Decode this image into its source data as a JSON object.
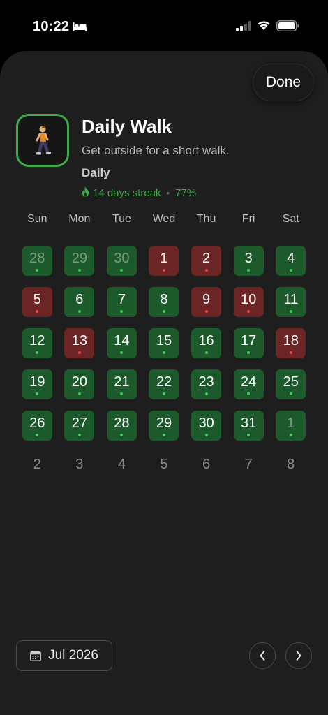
{
  "status_bar": {
    "time": "10:22",
    "icons": [
      "bed-icon",
      "cellular-signal-icon",
      "wifi-icon",
      "battery-icon"
    ]
  },
  "header": {
    "done_label": "Done"
  },
  "habit": {
    "icon": "person-walking-icon",
    "title": "Daily Walk",
    "description": "Get outside for a short walk.",
    "frequency": "Daily",
    "streak": "14 days streak",
    "separator": "•",
    "completion": "77%"
  },
  "calendar": {
    "weekdays": [
      "Sun",
      "Mon",
      "Tue",
      "Wed",
      "Thu",
      "Fri",
      "Sat"
    ],
    "days": [
      {
        "label": "28",
        "state": "done",
        "other_month": true
      },
      {
        "label": "29",
        "state": "done",
        "other_month": true
      },
      {
        "label": "30",
        "state": "done",
        "other_month": true
      },
      {
        "label": "1",
        "state": "missed",
        "other_month": false
      },
      {
        "label": "2",
        "state": "missed",
        "other_month": false
      },
      {
        "label": "3",
        "state": "done",
        "other_month": false
      },
      {
        "label": "4",
        "state": "done",
        "other_month": false
      },
      {
        "label": "5",
        "state": "missed",
        "other_month": false
      },
      {
        "label": "6",
        "state": "done",
        "other_month": false
      },
      {
        "label": "7",
        "state": "done",
        "other_month": false
      },
      {
        "label": "8",
        "state": "done",
        "other_month": false
      },
      {
        "label": "9",
        "state": "missed",
        "other_month": false
      },
      {
        "label": "10",
        "state": "missed",
        "other_month": false
      },
      {
        "label": "11",
        "state": "done",
        "other_month": false
      },
      {
        "label": "12",
        "state": "done",
        "other_month": false
      },
      {
        "label": "13",
        "state": "missed",
        "other_month": false
      },
      {
        "label": "14",
        "state": "done",
        "other_month": false
      },
      {
        "label": "15",
        "state": "done",
        "other_month": false
      },
      {
        "label": "16",
        "state": "done",
        "other_month": false
      },
      {
        "label": "17",
        "state": "done",
        "other_month": false
      },
      {
        "label": "18",
        "state": "missed",
        "other_month": false
      },
      {
        "label": "19",
        "state": "done",
        "other_month": false
      },
      {
        "label": "20",
        "state": "done",
        "other_month": false
      },
      {
        "label": "21",
        "state": "done",
        "other_month": false
      },
      {
        "label": "22",
        "state": "done",
        "other_month": false
      },
      {
        "label": "23",
        "state": "done",
        "other_month": false
      },
      {
        "label": "24",
        "state": "done",
        "other_month": false
      },
      {
        "label": "25",
        "state": "done",
        "other_month": false
      },
      {
        "label": "26",
        "state": "done",
        "other_month": false
      },
      {
        "label": "27",
        "state": "done",
        "other_month": false
      },
      {
        "label": "28",
        "state": "done",
        "other_month": false
      },
      {
        "label": "29",
        "state": "done",
        "other_month": false
      },
      {
        "label": "30",
        "state": "done",
        "other_month": false
      },
      {
        "label": "31",
        "state": "done",
        "other_month": false
      },
      {
        "label": "1",
        "state": "done",
        "other_month": true
      },
      {
        "label": "2",
        "state": "none",
        "other_month": true
      },
      {
        "label": "3",
        "state": "none",
        "other_month": true
      },
      {
        "label": "4",
        "state": "none",
        "other_month": true
      },
      {
        "label": "5",
        "state": "none",
        "other_month": true
      },
      {
        "label": "6",
        "state": "none",
        "other_month": true
      },
      {
        "label": "7",
        "state": "none",
        "other_month": true
      },
      {
        "label": "8",
        "state": "none",
        "other_month": true
      }
    ]
  },
  "footer": {
    "month_label": "Jul 2026",
    "month_icon": "calendar-icon",
    "prev_icon": "chevron-left-icon",
    "next_icon": "chevron-right-icon"
  },
  "colors": {
    "done": "#1d5a2b",
    "missed": "#6b2524",
    "accent_green": "#3ea84a",
    "sheet_background": "#1e1e1f"
  }
}
